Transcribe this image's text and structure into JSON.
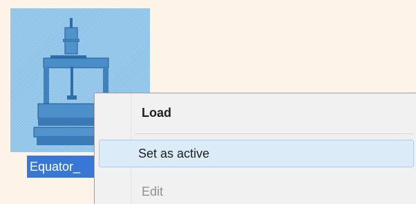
{
  "thumbnail": {
    "caption": "Equator_"
  },
  "context_menu": {
    "items": [
      {
        "label": "Load",
        "bold": true,
        "highlighted": false
      },
      {
        "label": "Set as active",
        "bold": false,
        "highlighted": true
      },
      {
        "label": "Edit",
        "bold": false,
        "highlighted": false,
        "partially_visible": true
      }
    ]
  }
}
